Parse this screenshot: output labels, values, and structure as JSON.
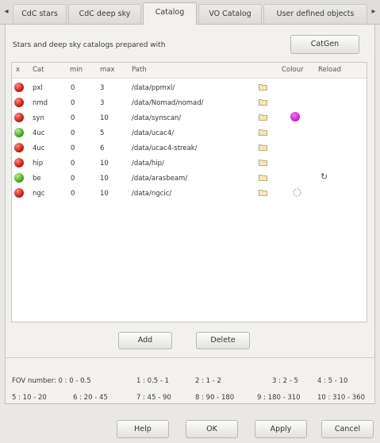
{
  "tabs": [
    {
      "label": "CdC stars"
    },
    {
      "label": "CdC deep sky"
    },
    {
      "label": "Catalog"
    },
    {
      "label": "VO Catalog"
    },
    {
      "label": "User defined objects"
    }
  ],
  "tab_scroll": {
    "left": "◂",
    "right": "▸"
  },
  "prepared_label": "Stars and deep sky catalogs prepared with",
  "catgen_button": "CatGen",
  "table": {
    "headers": {
      "x": "x",
      "cat": "Cat",
      "min": "min",
      "max": "max",
      "path": "Path",
      "colour": "Colour",
      "reload": "Reload"
    },
    "rows": [
      {
        "status": "red",
        "cat": "pxl",
        "min": "0",
        "max": "3",
        "path": "/data/ppmxl/",
        "colour": "",
        "reload": false
      },
      {
        "status": "red",
        "cat": "nmd",
        "min": "0",
        "max": "3",
        "path": "/data/Nomad/nomad/",
        "colour": "",
        "reload": false
      },
      {
        "status": "red",
        "cat": "syn",
        "min": "0",
        "max": "10",
        "path": "/data/synscan/",
        "colour": "#cc11cc",
        "reload": false
      },
      {
        "status": "green",
        "cat": "4uc",
        "min": "0",
        "max": "5",
        "path": "/data/ucac4/",
        "colour": "",
        "reload": false
      },
      {
        "status": "red",
        "cat": "4uc",
        "min": "0",
        "max": "6",
        "path": "/data/ucac4-streak/",
        "colour": "",
        "reload": false
      },
      {
        "status": "red",
        "cat": "hip",
        "min": "0",
        "max": "10",
        "path": "/data/hip/",
        "colour": "",
        "reload": false
      },
      {
        "status": "green",
        "cat": "be",
        "min": "0",
        "max": "10",
        "path": "/data/arasbeam/",
        "colour": "",
        "reload": true
      },
      {
        "status": "red",
        "cat": "ngc",
        "min": "0",
        "max": "10",
        "path": "/data/ngcic/",
        "colour": "spinner",
        "reload": false
      }
    ]
  },
  "add_button": "Add",
  "delete_button": "Delete",
  "fov": {
    "row1": [
      "FOV number:  0 : 0 - 0.5",
      "1 : 0.5 - 1",
      "2 : 1 - 2",
      "3 : 2 - 5",
      "4 : 5 - 10"
    ],
    "row2": [
      "5 : 10 - 20",
      "6 : 20 - 45",
      "7 : 45 - 90",
      "8 : 90 - 180",
      "9 : 180 - 310",
      "10 : 310 - 360"
    ]
  },
  "dialog_buttons": {
    "help": "Help",
    "ok": "OK",
    "apply": "Apply",
    "cancel": "Cancel"
  },
  "colors": {
    "red_status": "#c4221a",
    "green_status": "#47a82a",
    "magenta": "#cc11cc"
  }
}
